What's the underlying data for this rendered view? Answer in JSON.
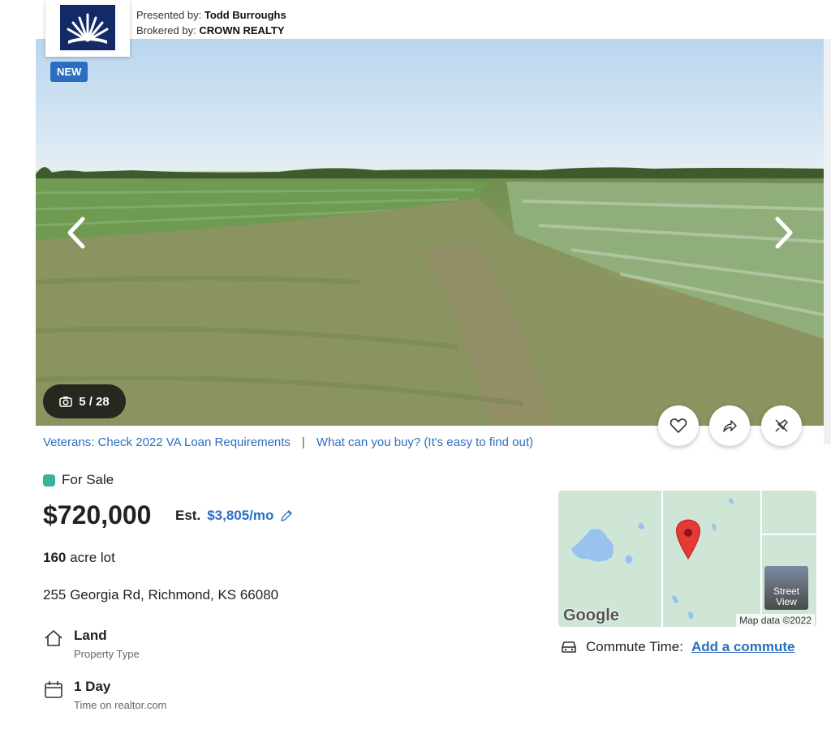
{
  "header": {
    "presented_by_label": "Presented by:",
    "presented_by_name": "Todd Burroughs",
    "brokered_by_label": "Brokered by:",
    "brokered_by_name": "CROWN REALTY"
  },
  "photo": {
    "badge": "NEW",
    "counter": "5 / 28"
  },
  "links": {
    "va_loan": "Veterans: Check 2022 VA Loan Requirements",
    "separator": "|",
    "what_can_you_buy": "What can you buy? (It's easy to find out)"
  },
  "listing": {
    "status": "For Sale",
    "status_color": "#3bb39a",
    "price": "$720,000",
    "est_label": "Est.",
    "est_value": "$3,805/mo",
    "lot_size": "160",
    "lot_unit": "acre lot",
    "address": "255 Georgia Rd, Richmond, KS 66080",
    "facts": [
      {
        "icon": "house-icon",
        "title": "Land",
        "subtitle": "Property Type"
      },
      {
        "icon": "calendar-icon",
        "title": "1 Day",
        "subtitle": "Time on realtor.com"
      }
    ]
  },
  "map": {
    "google_logo": "Google",
    "map_data": "Map data ©2022",
    "street_view": "Street View"
  },
  "commute": {
    "label": "Commute Time:",
    "link": "Add a commute"
  },
  "colors": {
    "accent": "#2a6ec2",
    "logo_bg": "#132a66"
  }
}
